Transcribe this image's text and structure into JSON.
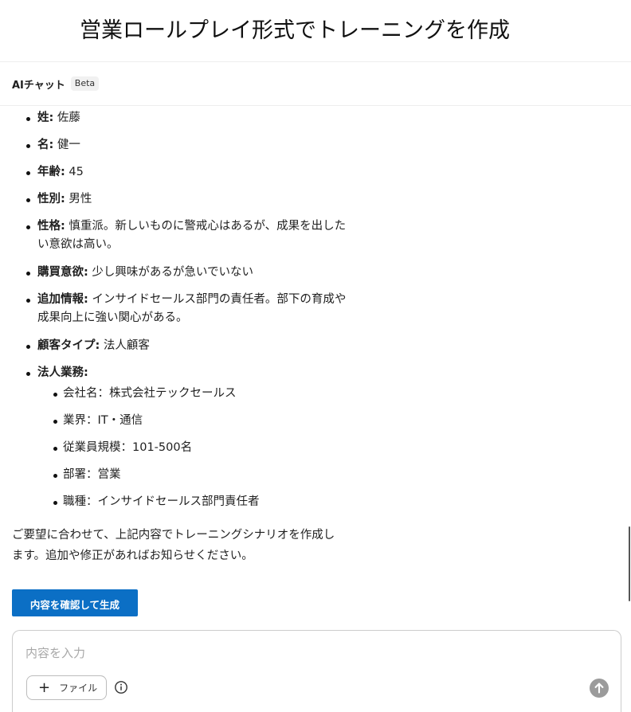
{
  "page": {
    "title": "営業ロールプレイ形式でトレーニングを作成"
  },
  "chat": {
    "title": "AIチャット",
    "badge": "Beta"
  },
  "profile": {
    "items": [
      {
        "key": "姓:",
        "value": " 佐藤"
      },
      {
        "key": "名:",
        "value": " 健一"
      },
      {
        "key": "年齢:",
        "value": " 45"
      },
      {
        "key": "性別:",
        "value": " 男性"
      },
      {
        "key": "性格:",
        "value": " 慎重派。新しいものに警戒心はあるが、成果を出した",
        "value2": "い意欲は高い。"
      },
      {
        "key": "購買意欲:",
        "value": " 少し興味があるが急いでいない"
      },
      {
        "key": "追加情報:",
        "value": " インサイドセールス部門の責任者。部下の育成や",
        "value2": "成果向上に強い関心がある。"
      },
      {
        "key": "顧客タイプ:",
        "value": " 法人顧客"
      },
      {
        "key": "法人業務:",
        "value": ""
      }
    ],
    "sub_items": [
      "会社名：株式会社テックセールス",
      "業界：IT・通信",
      "従業員規模：101-500名",
      "部署：営業",
      "職種：インサイドセールス部門責任者"
    ]
  },
  "closing": {
    "line1": "ご要望に合わせて、上記内容でトレーニングシナリオを作成し",
    "line2": "ます。追加や修正があればお知らせください。"
  },
  "actions": {
    "confirm_label": "内容を確認して生成"
  },
  "composer": {
    "placeholder": "内容を入力",
    "file_label": "ファイル"
  },
  "colors": {
    "accent": "#0b6fc5",
    "send_disabled": "#9b9b9b"
  }
}
